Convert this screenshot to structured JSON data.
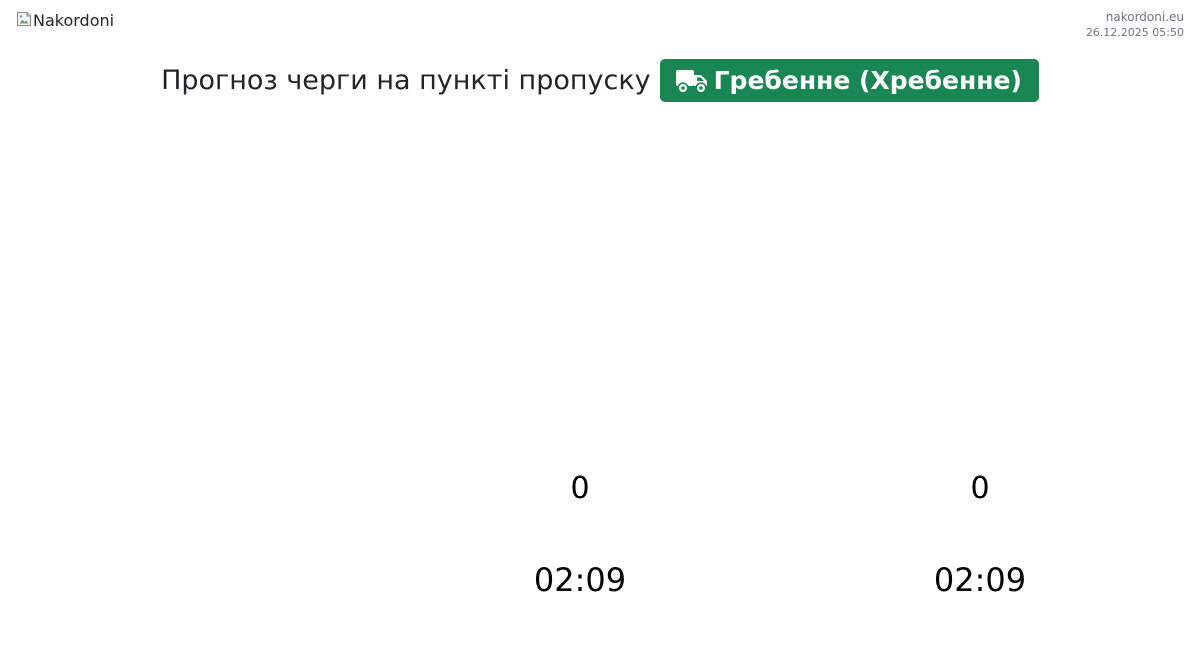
{
  "header": {
    "logo_alt": "Nakordoni",
    "site": "nakordoni.eu",
    "datetime": "26.12.2025 05:50"
  },
  "title": {
    "text": "Прогноз черги на пункті пропуску",
    "checkpoint": "Гребенне (Хребенне)",
    "icon": "truck-icon",
    "badge_color": "#198754"
  },
  "stats": [
    {
      "count": "0",
      "time": "02:09"
    },
    {
      "count": "0",
      "time": "02:09"
    }
  ]
}
